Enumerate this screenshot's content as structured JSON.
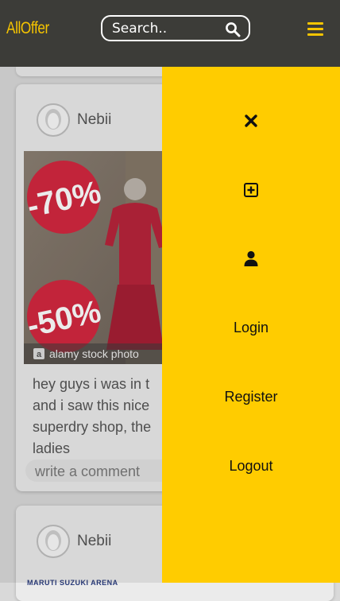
{
  "header": {
    "logo": "AllOffer",
    "search_placeholder": "Search..",
    "accent_color": "#ffcc00",
    "background_color": "#3c3c38",
    "menu_icon": "hamburger-icon",
    "search_icon": "search-icon"
  },
  "feed": {
    "posts": [
      {
        "author": "Nebii",
        "image_watermark": "alamy stock photo",
        "image_text": [
          "-70%",
          "-50%"
        ],
        "caption_lines": [
          "hey guys i was in t",
          "and i saw this nice",
          "superdry shop, the",
          "ladies"
        ],
        "comment_placeholder": "write a comment"
      },
      {
        "author": "Nebii",
        "image_text": "MARUTI SUZUKI ARENA"
      }
    ]
  },
  "side_menu": {
    "icons": [
      "close-icon",
      "add-post-icon",
      "user-icon"
    ],
    "items": [
      {
        "label": "Login"
      },
      {
        "label": "Register"
      },
      {
        "label": "Logout"
      }
    ]
  }
}
